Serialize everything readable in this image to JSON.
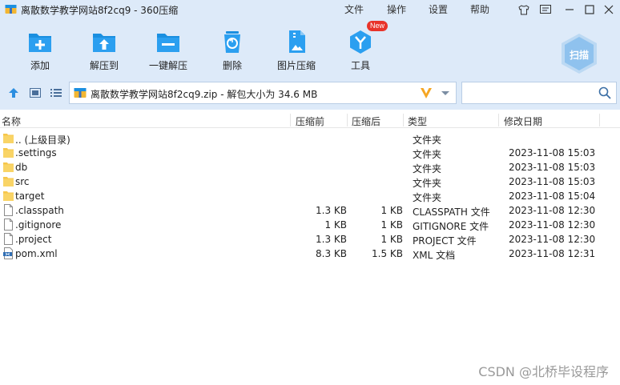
{
  "window": {
    "title": "离散数学教学网站8f2cq9 - 360压缩",
    "menu": [
      "文件",
      "操作",
      "设置",
      "帮助"
    ]
  },
  "toolbar": {
    "items": [
      {
        "label": "添加",
        "icon": "add-icon"
      },
      {
        "label": "解压到",
        "icon": "extract-to-icon"
      },
      {
        "label": "一键解压",
        "icon": "one-click-extract-icon"
      },
      {
        "label": "删除",
        "icon": "delete-icon"
      },
      {
        "label": "图片压缩",
        "icon": "image-compress-icon"
      },
      {
        "label": "工具",
        "icon": "tools-icon",
        "badge": "New"
      }
    ],
    "scan_label": "扫描"
  },
  "address": {
    "path": "离散数学教学网站8f2cq9.zip - 解包大小为 34.6 MB",
    "search_value": ""
  },
  "columns": {
    "name": "名称",
    "compressed": "压缩前",
    "after": "压缩后",
    "type": "类型",
    "modified": "修改日期"
  },
  "files": [
    {
      "name": ".. (上级目录)",
      "before": "",
      "after": "",
      "type": "文件夹",
      "date": "",
      "kind": "folder"
    },
    {
      "name": ".settings",
      "before": "",
      "after": "",
      "type": "文件夹",
      "date": "2023-11-08 15:03",
      "kind": "folder"
    },
    {
      "name": "db",
      "before": "",
      "after": "",
      "type": "文件夹",
      "date": "2023-11-08 15:03",
      "kind": "folder"
    },
    {
      "name": "src",
      "before": "",
      "after": "",
      "type": "文件夹",
      "date": "2023-11-08 15:03",
      "kind": "folder"
    },
    {
      "name": "target",
      "before": "",
      "after": "",
      "type": "文件夹",
      "date": "2023-11-08 15:04",
      "kind": "folder"
    },
    {
      "name": ".classpath",
      "before": "1.3 KB",
      "after": "1 KB",
      "type": "CLASSPATH 文件",
      "date": "2023-11-08 12:30",
      "kind": "file"
    },
    {
      "name": ".gitignore",
      "before": "1 KB",
      "after": "1 KB",
      "type": "GITIGNORE 文件",
      "date": "2023-11-08 12:30",
      "kind": "file"
    },
    {
      "name": ".project",
      "before": "1.3 KB",
      "after": "1 KB",
      "type": "PROJECT 文件",
      "date": "2023-11-08 12:30",
      "kind": "file"
    },
    {
      "name": "pom.xml",
      "before": "8.3 KB",
      "after": "1.5 KB",
      "type": "XML 文档",
      "date": "2023-11-08 12:31",
      "kind": "xml"
    }
  ],
  "watermark": "CSDN @北桥毕设程序",
  "colors": {
    "chrome": "#ddeaf9",
    "accent": "#1a8fe0",
    "folder": "#f6c64b"
  }
}
